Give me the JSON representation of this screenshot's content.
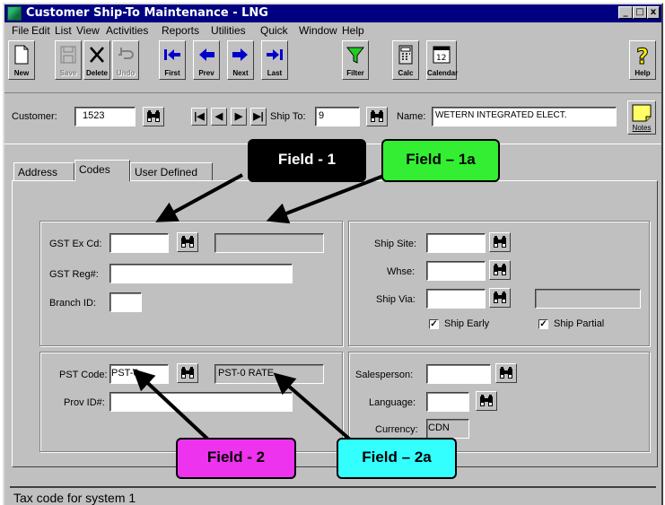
{
  "window": {
    "title": "Customer Ship-To Maintenance - LNG",
    "controls": [
      "_",
      "□",
      "x"
    ]
  },
  "menu": [
    "File",
    "Edit",
    "List",
    "View",
    "Activities",
    "Reports",
    "Utilities",
    "Quick",
    "Window",
    "Help"
  ],
  "toolbar": {
    "new": "New",
    "save": "Save",
    "delete": "Delete",
    "undo": "Undo",
    "first": "First",
    "prev": "Prev",
    "next": "Next",
    "last": "Last",
    "filter": "Filter",
    "calc": "Calc",
    "calendar": "Calendar",
    "help": "Help"
  },
  "customer": {
    "label": "Customer:",
    "value": "1523",
    "shipto_label": "Ship To:",
    "shipto_value": "9",
    "name_label": "Name:",
    "name_value": "WETERN INTEGRATED ELECT.",
    "notes": "Notes"
  },
  "nav": [
    "|◀",
    "◀",
    "▶",
    "▶|"
  ],
  "tabs": [
    "Address",
    "Codes",
    "User Defined"
  ],
  "codes": {
    "gst_ex_cd": "GST Ex Cd:",
    "gst_reg": "GST Reg#:",
    "branch_id": "Branch ID:",
    "pst_code": "PST Code:",
    "pst_code_value": "PST-0",
    "pst_desc": "PST-0 RATE",
    "prov_id": "Prov ID#:",
    "ship_site": "Ship Site:",
    "whse": "Whse:",
    "ship_via": "Ship Via:",
    "ship_early": "Ship Early",
    "ship_partial": "Ship Partial",
    "salesperson": "Salesperson:",
    "language": "Language:",
    "currency": "Currency:",
    "currency_value": "CDN"
  },
  "status": "Tax code for system 1",
  "callouts": {
    "f1": "Field - 1",
    "f1a": "Field – 1a",
    "f2": "Field - 2",
    "f2a": "Field – 2a"
  },
  "colors": {
    "title_bar": "#000080",
    "face": "#c0c0c0",
    "field1": "#000000",
    "field1a": "#33ee33",
    "field2": "#ee33ee",
    "field2a": "#33ffff"
  }
}
